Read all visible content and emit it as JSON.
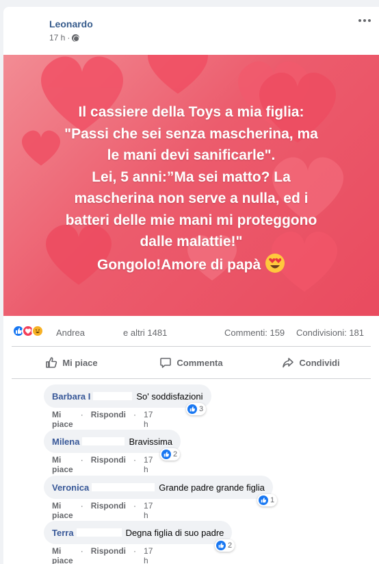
{
  "post": {
    "author": "Leonardo",
    "time": "17 h",
    "privacy_icon": "globe-icon",
    "image_text": "Il cassiere della Toys a mia figlia:\n\"Passi che sei senza mascherina, ma\nle mani devi sanificarle\".\nLei, 5 anni:”Ma sei matto? La\nmascherina non serve a nulla, ed i\nbatteri delle mie mani mi proteggono\ndalle malattie!\"\nGongolo!Amore di papà"
  },
  "stats": {
    "reaction_icons": [
      "like-icon",
      "love-icon",
      "haha-icon"
    ],
    "reactor_name": "Andrea",
    "reactor_others": "e altri 1481",
    "comments": "Commenti: 159",
    "shares": "Condivisioni: 181"
  },
  "actions": {
    "like": "Mi piace",
    "comment": "Commenta",
    "share": "Condividi"
  },
  "comments": [
    {
      "author": "Barbara I",
      "text": "So' soddisfazioni",
      "reactions": "3",
      "like": "Mi piace",
      "reply": "Rispondi",
      "time": "17 h"
    },
    {
      "author": "Milena",
      "text": "Bravissima",
      "reactions": "2",
      "like": "Mi piace",
      "reply": "Rispondi",
      "time": "17 h"
    },
    {
      "author": "Veronica",
      "text": "Grande padre grande figlia",
      "reactions": "1",
      "like": "Mi piace",
      "reply": "Rispondi",
      "time": "17 h"
    },
    {
      "author": "Terra",
      "text": "Degna figlia di suo padre",
      "reactions": "2",
      "like": "Mi piace",
      "reply": "Rispondi",
      "time": "17 h"
    }
  ],
  "colors": {
    "link": "#385898",
    "like_blue": "#1877f2",
    "photo_pink": "#ec5c6d",
    "muted": "#65676b"
  }
}
